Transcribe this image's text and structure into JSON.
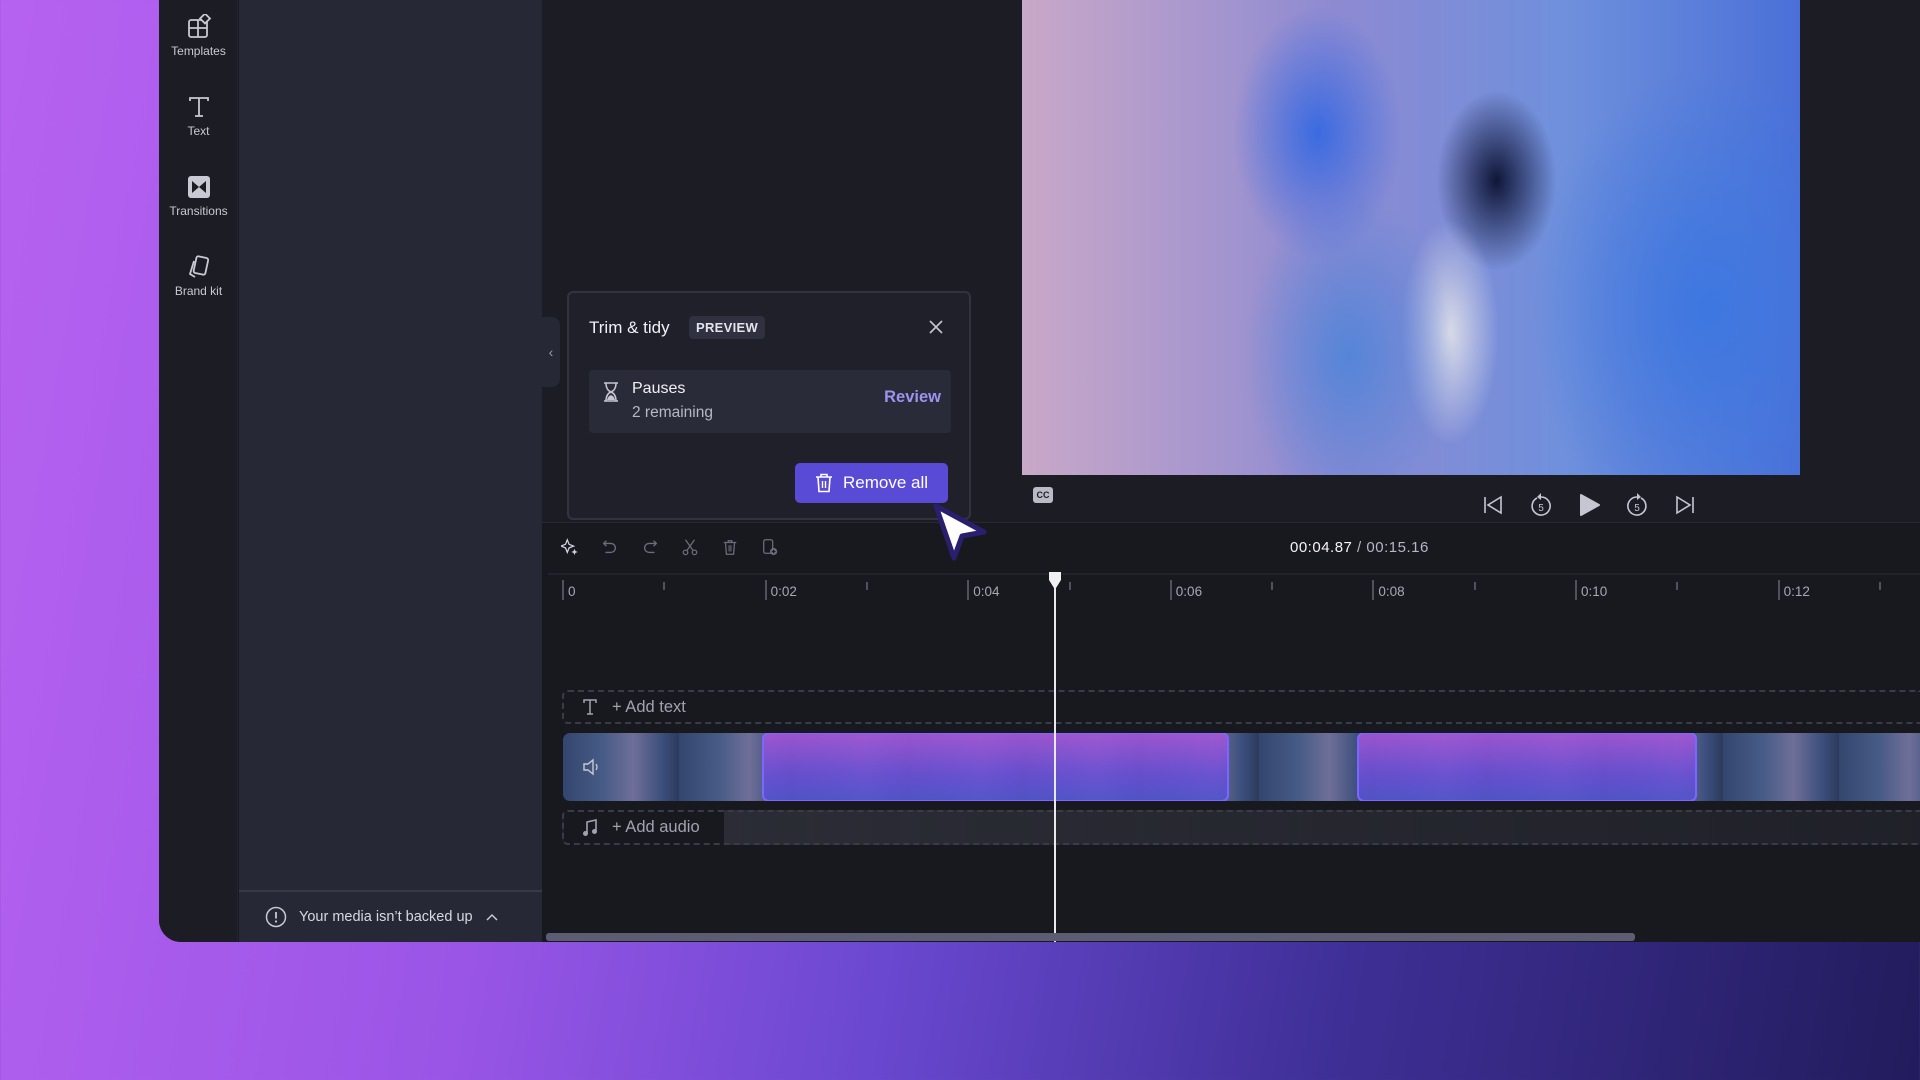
{
  "sidebar": {
    "items": [
      {
        "label": "Templates",
        "icon": "templates-icon"
      },
      {
        "label": "Text",
        "icon": "text-icon"
      },
      {
        "label": "Transitions",
        "icon": "transitions-icon"
      },
      {
        "label": "Brand kit",
        "icon": "brand-kit-icon"
      }
    ]
  },
  "panel": {
    "backup_status": "Your media isn’t backed up"
  },
  "popup": {
    "title": "Trim & tidy",
    "badge": "PREVIEW",
    "item": {
      "title": "Pauses",
      "subtitle": "2 remaining",
      "action": "Review"
    },
    "remove_all_label": "Remove all"
  },
  "player": {
    "cc_label": "CC",
    "controls": [
      "skip-to-start",
      "rewind-5",
      "play",
      "forward-5",
      "skip-to-end"
    ],
    "rewind_seconds": "5",
    "forward_seconds": "5"
  },
  "timeline": {
    "current_time": "00:04.87",
    "separator": " / ",
    "total_time": "00:15.16",
    "ruler_labels": [
      "0",
      "0:02",
      "0:04",
      "0:06",
      "0:08",
      "0:10",
      "0:12"
    ],
    "add_text_label": "+ Add text",
    "add_audio_label": "+ Add audio",
    "toolbar": [
      "ai-tools",
      "undo",
      "redo",
      "split",
      "delete",
      "duplicate"
    ],
    "highlighted_pauses_seconds": [
      [
        1.97,
        6.58
      ],
      [
        7.85,
        11.2
      ]
    ],
    "playhead_seconds": 4.87
  },
  "colors": {
    "accent": "#5a4bd6",
    "link": "#9d93ef",
    "selection_border": "#7b67ff"
  }
}
